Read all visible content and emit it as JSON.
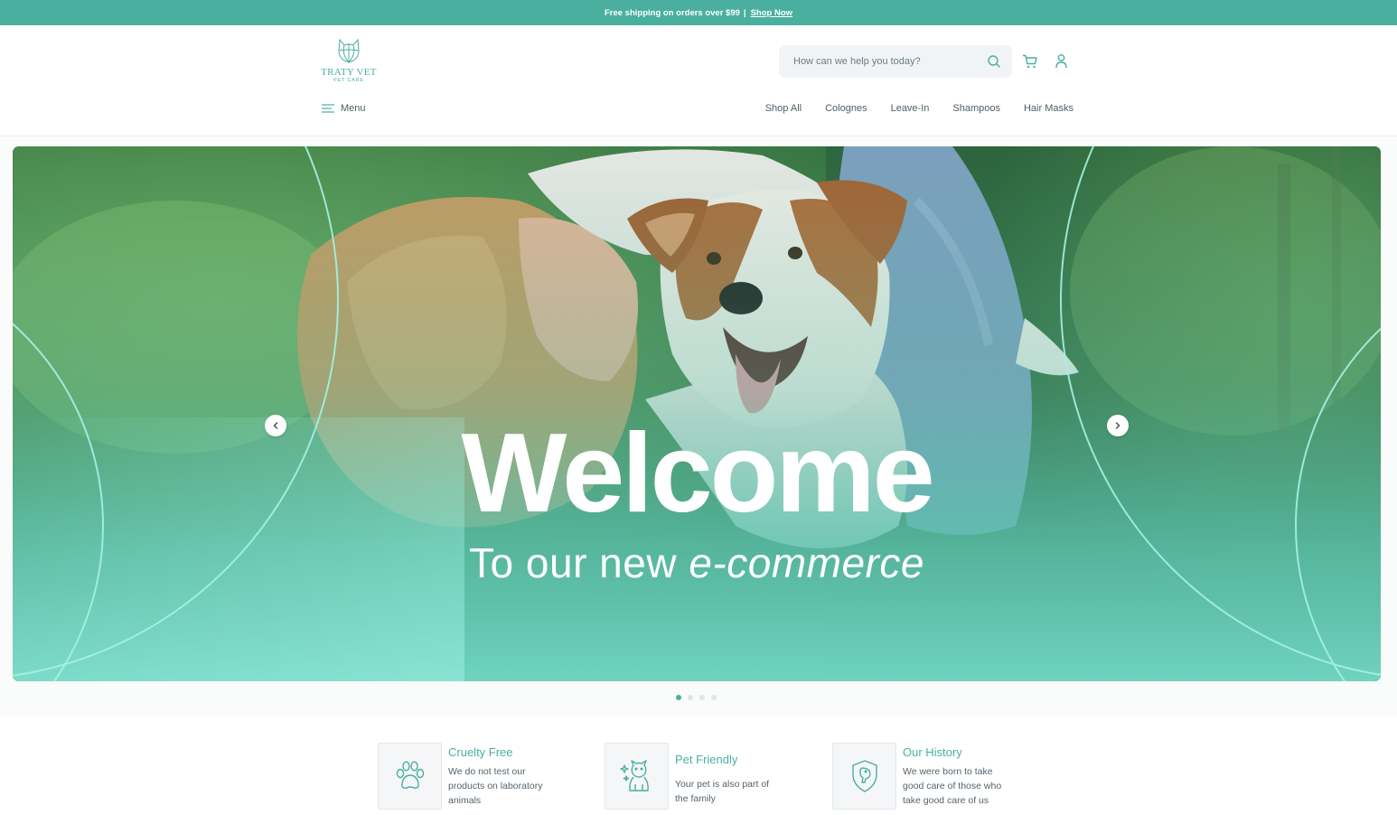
{
  "announcement": {
    "text": "Free shipping on orders over $99",
    "separator": "|",
    "link": "Shop Now"
  },
  "header": {
    "logo": {
      "brand": "TRATY VET",
      "sub": "PET CARE"
    },
    "search": {
      "placeholder": "How can we help you today?",
      "value": ""
    },
    "menu_label": "Menu",
    "nav": [
      "Shop All",
      "Colognes",
      "Leave-In",
      "Shampoos",
      "Hair Masks"
    ]
  },
  "hero": {
    "title": "Welcome",
    "subtitle_plain": "To our new ",
    "subtitle_italic": "e-commerce",
    "slides": 4,
    "active_slide": 1
  },
  "features": [
    {
      "title": "Cruelty Free",
      "desc": "We do not test our products on laboratory animals",
      "icon": "paw-icon"
    },
    {
      "title": "Pet Friendly",
      "desc": "Your pet is also part of the family",
      "icon": "dog-sparkle-icon"
    },
    {
      "title": "Our History",
      "desc": "We were born to take good care of those who take good care of us",
      "icon": "shield-dog-icon"
    }
  ],
  "colors": {
    "accent": "#4aaf9f",
    "text": "#3b4a52",
    "search_bg": "#f1f4f6"
  }
}
